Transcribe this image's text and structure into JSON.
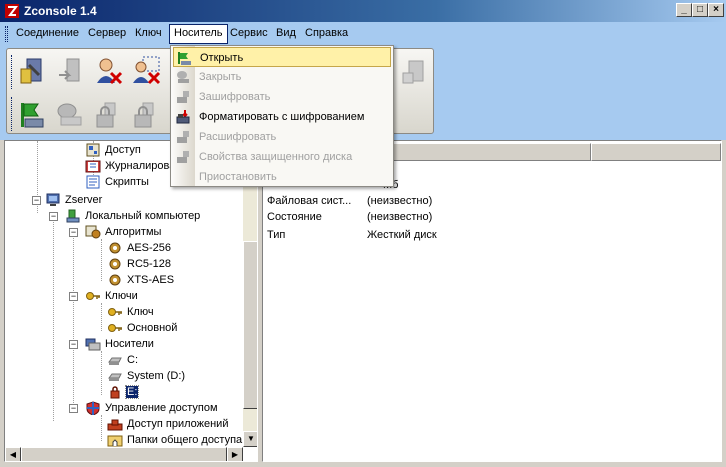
{
  "window": {
    "title": "Zconsole 1.4",
    "minimize": "_",
    "maximize": "□",
    "close": "×"
  },
  "menubar": {
    "items": [
      "Соединение",
      "Сервер",
      "Ключ",
      "Носитель",
      "Сервис",
      "Вид",
      "Справка"
    ],
    "active": "Носитель"
  },
  "dropdown": {
    "items": [
      {
        "label": "Открыть",
        "enabled": true,
        "highlighted": true,
        "icon": "open-disk-icon"
      },
      {
        "label": "Закрыть",
        "enabled": false,
        "icon": "close-disk-icon"
      },
      {
        "label": "Зашифровать",
        "enabled": false,
        "icon": "encrypt-disk-icon"
      },
      {
        "label": "Форматировать с шифрованием",
        "enabled": true,
        "icon": "format-encrypt-icon"
      },
      {
        "label": "Расшифровать",
        "enabled": false,
        "icon": "decrypt-disk-icon"
      },
      {
        "label": "Свойства защищенного диска",
        "enabled": false,
        "icon": "disk-properties-icon"
      },
      {
        "label": "Приостановить",
        "enabled": false,
        "icon": "pause-icon"
      }
    ]
  },
  "tree": {
    "nodes": [
      {
        "label": "Доступ",
        "icon": "access-icon"
      },
      {
        "label": "Журналирование",
        "icon": "journal-icon"
      },
      {
        "label": "Скрипты",
        "icon": "scripts-icon"
      },
      {
        "label": "Zserver",
        "icon": "server-icon"
      },
      {
        "label": "Локальный компьютер",
        "icon": "computer-icon"
      },
      {
        "label": "Алгоритмы",
        "icon": "algorithms-icon"
      },
      {
        "label": "AES-256",
        "icon": "gear-icon"
      },
      {
        "label": "RC5-128",
        "icon": "gear-icon"
      },
      {
        "label": "XTS-AES",
        "icon": "gear-icon"
      },
      {
        "label": "Ключи",
        "icon": "key-icon"
      },
      {
        "label": "Ключ",
        "icon": "key-icon"
      },
      {
        "label": "Основной",
        "icon": "key-icon"
      },
      {
        "label": "Носители",
        "icon": "media-icon"
      },
      {
        "label": "C:",
        "icon": "drive-icon"
      },
      {
        "label": "System (D:)",
        "icon": "drive-icon"
      },
      {
        "label": "E:",
        "icon": "locked-drive-icon",
        "selected": true
      },
      {
        "label": "Управление доступом",
        "icon": "access-control-icon"
      },
      {
        "label": "Доступ приложений",
        "icon": "app-access-icon"
      },
      {
        "label": "Папки общего доступа",
        "icon": "shared-folder-icon"
      }
    ]
  },
  "details": {
    "header_name_partial": "",
    "header_value": "ение",
    "rows": [
      {
        "name": "",
        "value": "Мб"
      },
      {
        "name": "Файловая сист...",
        "value": "(неизвестно)"
      },
      {
        "name": "Состояние",
        "value": "(неизвестно)"
      },
      {
        "name": "Тип",
        "value": "Жесткий диск"
      }
    ]
  },
  "colors": {
    "menubar_bg": "#a6caf0",
    "highlight": "#fff1a8",
    "selection": "#0a246a"
  }
}
